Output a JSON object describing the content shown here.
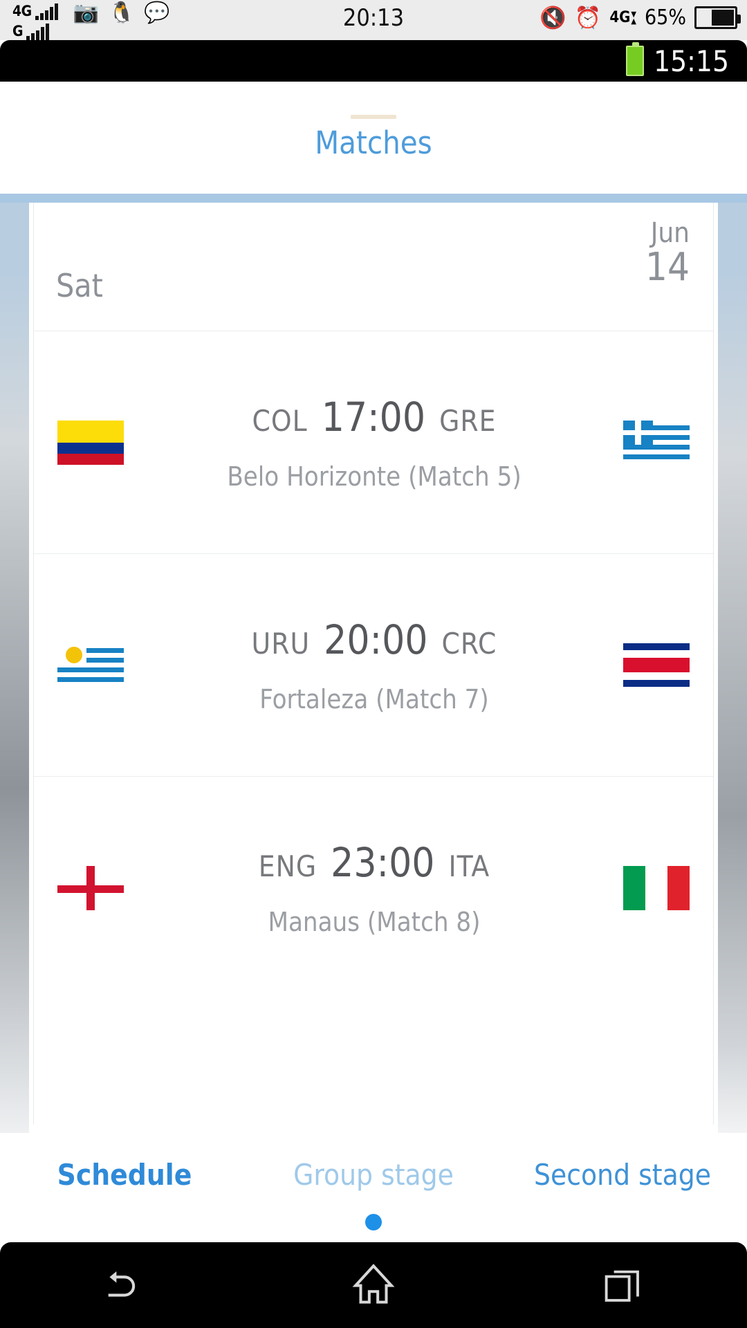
{
  "os_statusbar": {
    "network_primary": "4G",
    "network_secondary": "G",
    "clock": "20:13",
    "data_label": "4G",
    "battery_percent": "65%",
    "icons": [
      "photo-icon",
      "penguin-icon",
      "chat-icon",
      "mute-icon",
      "alarm-icon"
    ]
  },
  "app_statusbar": {
    "clock": "15:15"
  },
  "header": {
    "title": "Matches"
  },
  "schedule": {
    "date": {
      "day_of_week": "Sat",
      "month": "Jun",
      "day": "14"
    },
    "matches": [
      {
        "home_abbr": "COL",
        "away_abbr": "GRE",
        "kickoff": "17:00",
        "venue": "Belo Horizonte (Match  5)",
        "home_flag": "colombia-flag",
        "away_flag": "greece-flag"
      },
      {
        "home_abbr": "URU",
        "away_abbr": "CRC",
        "kickoff": "20:00",
        "venue": "Fortaleza (Match  7)",
        "home_flag": "uruguay-flag",
        "away_flag": "costa-rica-flag"
      },
      {
        "home_abbr": "ENG",
        "away_abbr": "ITA",
        "kickoff": "23:00",
        "venue": "Manaus (Match  8)",
        "home_flag": "england-flag",
        "away_flag": "italy-flag"
      }
    ]
  },
  "tabs": [
    {
      "label": "Schedule",
      "state": "active"
    },
    {
      "label": "Group stage",
      "state": "inactive"
    },
    {
      "label": "Second stage",
      "state": "alt"
    }
  ],
  "navbar": {
    "back": "back-icon",
    "home": "home-icon",
    "recents": "recents-icon"
  },
  "colors": {
    "accent_blue": "#2f8ad8",
    "title_blue": "#4e9cdb",
    "inactive_blue": "#9fc9ea",
    "list_border_blue": "#a8c7e3",
    "dot_blue": "#1e90e8",
    "text_grey": "#8d9197",
    "venue_grey": "#9b9ea3"
  }
}
